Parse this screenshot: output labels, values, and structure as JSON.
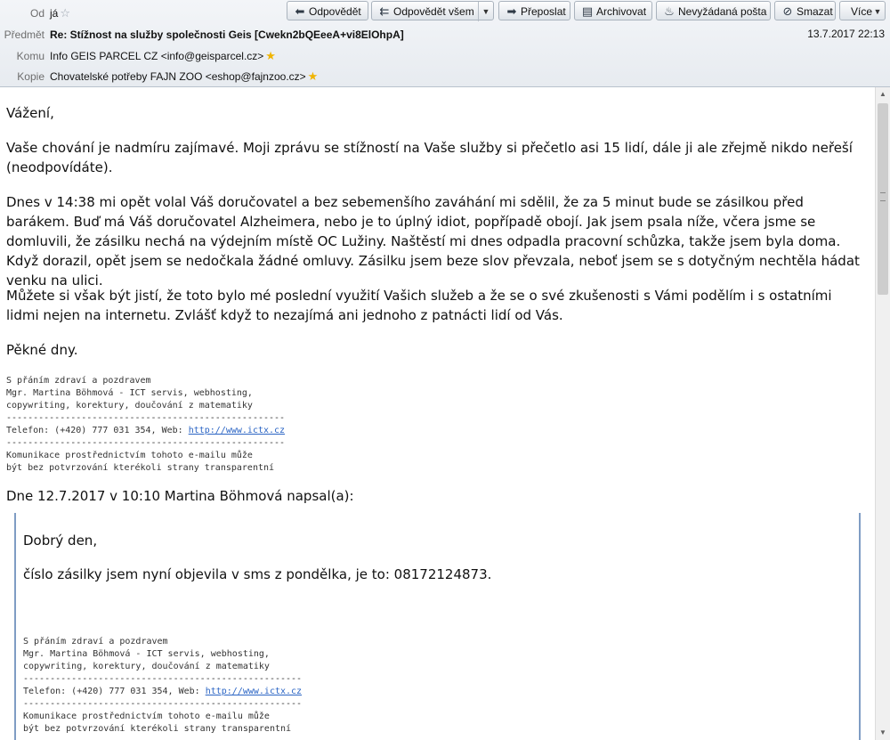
{
  "header": {
    "from_label": "Od",
    "from_value": "já",
    "subject_label": "Předmět",
    "subject_value": "Re: Stížnost na služby společnosti Geis [Cwekn2bQEeeA+vi8ElOhpA]",
    "date": "13.7.2017 22:13",
    "to_label": "Komu",
    "to_value": "Info GEIS PARCEL CZ <info@geisparcel.cz>",
    "cc_label": "Kopie",
    "cc_value": "Chovatelské potřeby FAJN ZOO <eshop@fajnzoo.cz>"
  },
  "toolbar": {
    "reply": "Odpovědět",
    "reply_all": "Odpovědět všem",
    "forward": "Přeposlat",
    "archive": "Archivovat",
    "junk": "Nevyžádaná pošta",
    "delete": "Smazat",
    "more": "Více"
  },
  "icons": {
    "reply": "reply-icon",
    "reply_all": "reply-all-icon",
    "forward": "forward-icon",
    "archive": "archive-icon",
    "junk": "junk-icon",
    "delete": "delete-icon",
    "star": "star-icon"
  },
  "colors": {
    "link": "#2a64c4",
    "quote_border": "#7f9dc4",
    "star": "#f0b400"
  },
  "body": {
    "greeting": "Vážení,",
    "p1": "Vaše chování je nadmíru zajímavé. Moji zprávu se stížností na Vaše služby si přečetlo asi 15 lidí, dále ji ale zřejmě nikdo neřeší (neodpovídáte).",
    "p2": "Dnes v 14:38 mi opět volal Váš doručovatel a bez sebemenšího zaváhání mi sdělil, že za 5 minut bude se zásilkou před barákem. Buď má Váš doručovatel Alzheimera, nebo je to úplný idiot, popřípadě obojí. Jak jsem psala níže, včera jsme se domluvili, že zásilku nechá na výdejním místě OC Lužiny. Naštěstí mi dnes odpadla pracovní schůzka, takže jsem byla doma. Když dorazil, opět jsem se nedočkala žádné omluvy. Zásilku jsem beze slov převzala, neboť jsem se s dotyčným nechtěla hádat venku na ulici.",
    "p3": "Můžete si však být jistí, že toto bylo mé poslední využití Vašich služeb a že se o své zkušenosti s Vámi podělím i s ostatními lidmi nejen na internetu. Zvlášť když to nezajímá ani jednoho z patnácti lidí od Vás.",
    "closing": "Pěkné dny.",
    "sig_line1": "S přáním zdraví a pozdravem",
    "sig_line2": "Mgr. Martina Böhmová - ICT servis, webhosting,",
    "sig_line3": "copywriting, korektury, doučování z matematiky",
    "sig_sep": "----------------------------------------------------",
    "sig_phone": "Telefon: (+420) 777 031 354, Web: ",
    "sig_link": "http://www.ictx.cz",
    "sig_line5": "Komunikace prostřednictvím tohoto e-mailu může",
    "sig_line6": "být bez potvrzování kterékoli strany transparentní",
    "quote_header": "Dne 12.7.2017 v 10:10 Martina Böhmová napsal(a):"
  },
  "quote": {
    "greeting": "Dobrý den,",
    "p1": "číslo zásilky jsem nyní objevila v sms z pondělka, je to: 08172124873."
  }
}
